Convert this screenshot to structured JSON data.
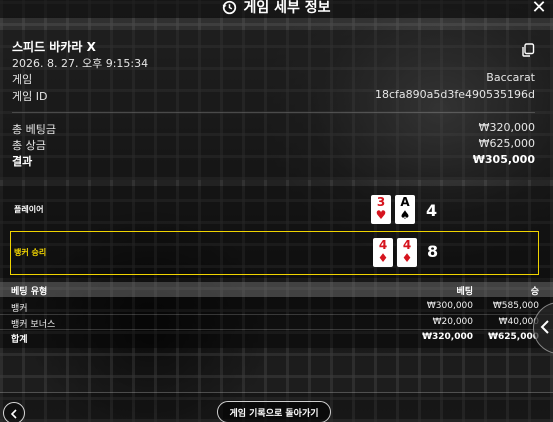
{
  "header": {
    "title": "게임 세부 정보",
    "icons": {
      "history": "history-icon",
      "close": "close-icon"
    }
  },
  "summary": {
    "game_name": "스피드 바카라 X",
    "datetime": "2026. 8. 27. 오후 9:15:34",
    "game_label": "게임",
    "game_value": "Baccarat",
    "game_id_label": "게임 ID",
    "game_id_value": "18cfa890a5d3fe490535196d",
    "total_bet_label": "총 베팅금",
    "total_bet_value": "₩320,000",
    "total_payout_label": "총 상금",
    "total_payout_value": "₩625,000",
    "result_label": "결과",
    "result_value": "₩305,000",
    "copy_icon": "copy-icon"
  },
  "hands": {
    "player": {
      "label": "플레이어",
      "score": "4",
      "cards": [
        {
          "rank": "3",
          "suit": "♥",
          "color": "red"
        },
        {
          "rank": "A",
          "suit": "♠",
          "color": "black"
        }
      ]
    },
    "banker": {
      "label": "뱅커 승리",
      "score": "8",
      "cards": [
        {
          "rank": "4",
          "suit": "♦",
          "color": "red"
        },
        {
          "rank": "4",
          "suit": "♦",
          "color": "red"
        }
      ]
    }
  },
  "bets": {
    "headers": [
      "베팅 유형",
      "베팅",
      "승"
    ],
    "rows": [
      {
        "type": "뱅커",
        "bet": "₩300,000",
        "win": "₩585,000"
      },
      {
        "type": "뱅커 보너스",
        "bet": "₩20,000",
        "win": "₩40,000"
      },
      {
        "type": "합계",
        "bet": "₩320,000",
        "win": "₩625,000"
      }
    ]
  },
  "footer": {
    "back_label": "게임 기록으로 돌아가기"
  },
  "colors": {
    "highlight": "#f0d400",
    "card_red": "#d6141e"
  }
}
